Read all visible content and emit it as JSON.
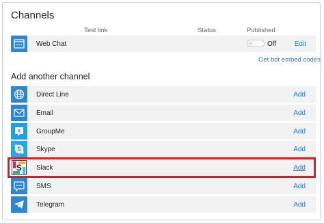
{
  "channels": {
    "title": "Channels",
    "columns": {
      "test_link": "Test link",
      "status": "Status",
      "published": "Published"
    },
    "web_chat": {
      "name": "Web Chat",
      "status": "Off",
      "action": "Edit"
    },
    "embed_link": "Get bot embed codes"
  },
  "add_channel": {
    "title": "Add another channel",
    "items": [
      {
        "name": "Direct Line",
        "action": "Add",
        "icon": "globe-icon"
      },
      {
        "name": "Email",
        "action": "Add",
        "icon": "envelope-icon"
      },
      {
        "name": "GroupMe",
        "action": "Add",
        "icon": "groupme-icon"
      },
      {
        "name": "Skype",
        "action": "Add",
        "icon": "skype-icon"
      },
      {
        "name": "Slack",
        "action": "Add",
        "icon": "slack-icon"
      },
      {
        "name": "SMS",
        "action": "Add",
        "icon": "sms-icon"
      },
      {
        "name": "Telegram",
        "action": "Add",
        "icon": "telegram-icon"
      }
    ]
  },
  "colors": {
    "accent": "#1c7ed6",
    "icon_bg": "#2d86d2",
    "highlight": "#d61f26",
    "row_bg": "#f2f2f2"
  }
}
